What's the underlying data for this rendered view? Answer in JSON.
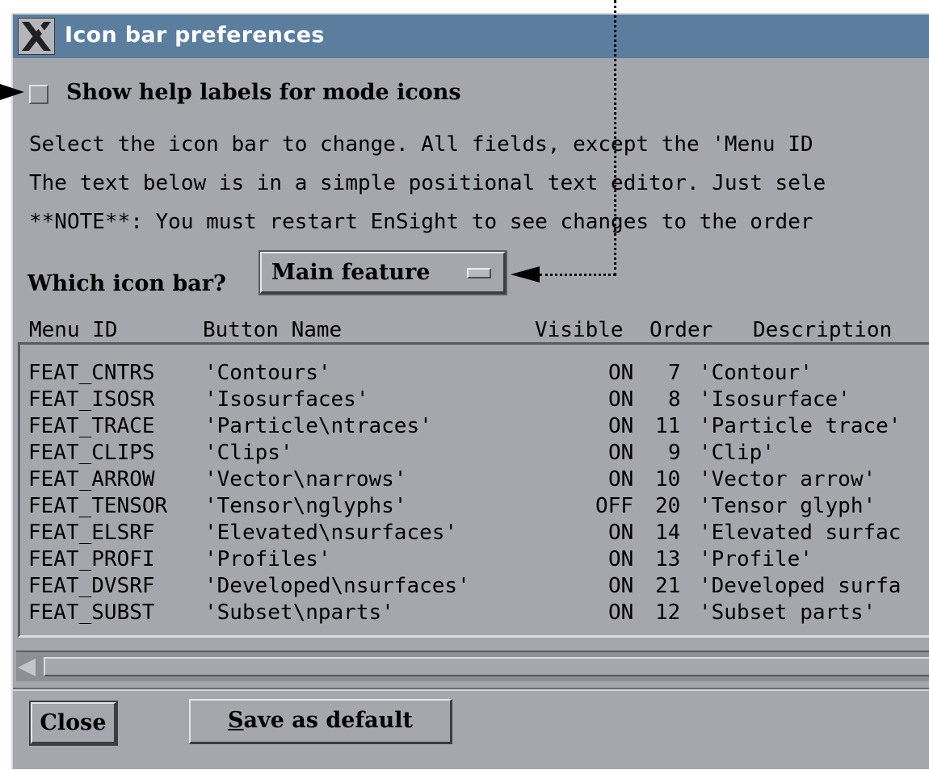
{
  "window": {
    "title": "Icon bar preferences",
    "logo_icon": "x-window-icon"
  },
  "show_help": {
    "label": "Show help labels for mode icons",
    "checked": false
  },
  "info_lines": [
    "Select the icon bar to change. All fields, except the 'Menu ID",
    "The text below is in a simple positional text editor. Just sele",
    "**NOTE**: You must restart EnSight to see changes to the order"
  ],
  "icon_bar": {
    "label": "Which icon bar?",
    "selected": "Main feature"
  },
  "columns": {
    "menu_id": "Menu ID",
    "button_name": "Button Name",
    "visible": "Visible",
    "order": "Order",
    "description": "Description"
  },
  "rows": [
    {
      "menu_id": "FEAT_CNTRS",
      "button_name": "'Contours'",
      "visible": "ON",
      "order": "7",
      "description": "'Contour'"
    },
    {
      "menu_id": "FEAT_ISOSR",
      "button_name": "'Isosurfaces'",
      "visible": "ON",
      "order": "8",
      "description": "'Isosurface'"
    },
    {
      "menu_id": "FEAT_TRACE",
      "button_name": "'Particle\\ntraces'",
      "visible": "ON",
      "order": "11",
      "description": "'Particle trace'"
    },
    {
      "menu_id": "FEAT_CLIPS",
      "button_name": "'Clips'",
      "visible": "ON",
      "order": "9",
      "description": "'Clip'"
    },
    {
      "menu_id": "FEAT_ARROW",
      "button_name": "'Vector\\narrows'",
      "visible": "ON",
      "order": "10",
      "description": "'Vector arrow'"
    },
    {
      "menu_id": "FEAT_TENSOR",
      "button_name": "'Tensor\\nglyphs'",
      "visible": "OFF",
      "order": "20",
      "description": "'Tensor glyph'"
    },
    {
      "menu_id": "FEAT_ELSRF",
      "button_name": "'Elevated\\nsurfaces'",
      "visible": "ON",
      "order": "14",
      "description": "'Elevated surfac"
    },
    {
      "menu_id": "FEAT_PROFI",
      "button_name": "'Profiles'",
      "visible": "ON",
      "order": "13",
      "description": "'Profile'"
    },
    {
      "menu_id": "FEAT_DVSRF",
      "button_name": "'Developed\\nsurfaces'",
      "visible": "ON",
      "order": "21",
      "description": "'Developed surfa"
    },
    {
      "menu_id": "FEAT_SUBST",
      "button_name": "'Subset\\nparts'",
      "visible": "ON",
      "order": "12",
      "description": "'Subset parts'"
    }
  ],
  "buttons": {
    "close": "Close",
    "save_first": "S",
    "save_rest": "ave as default"
  }
}
